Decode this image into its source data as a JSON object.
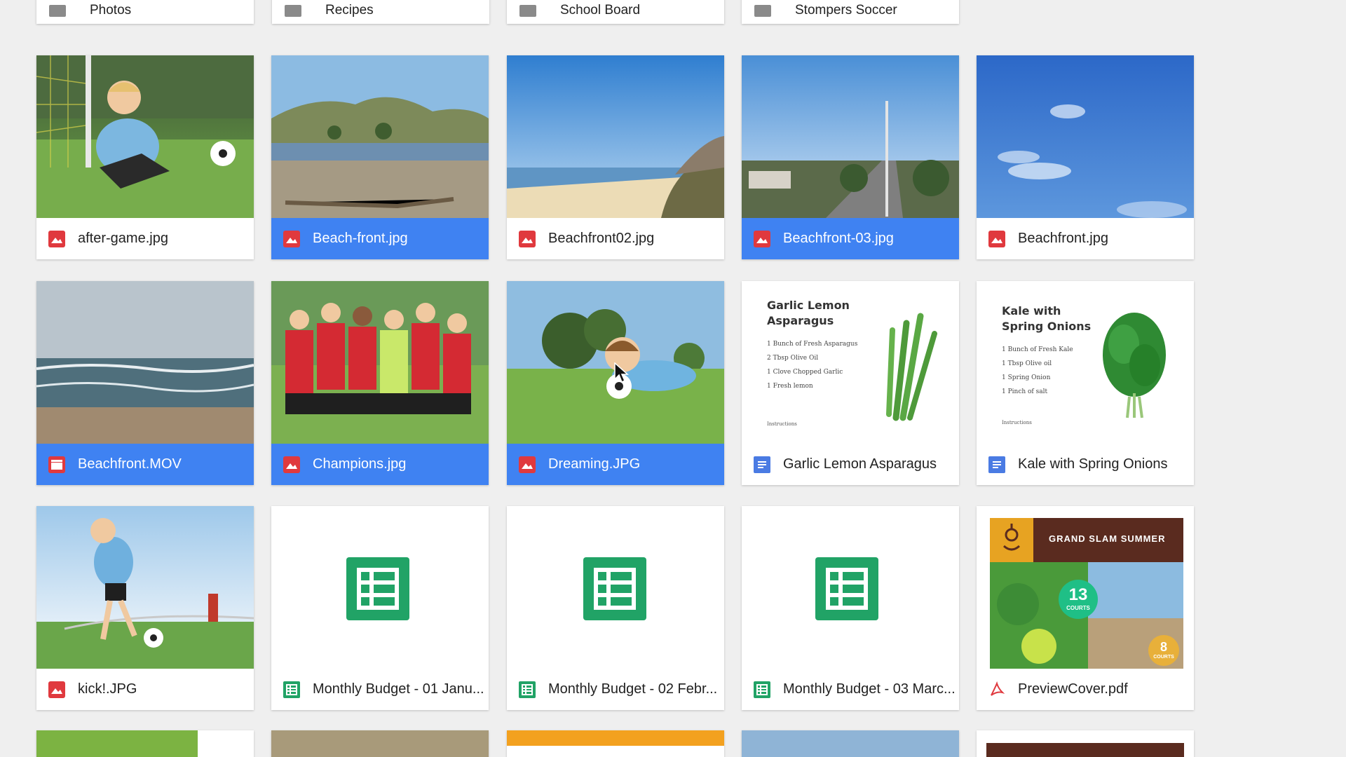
{
  "folders": [
    {
      "name": "Photos"
    },
    {
      "name": "Recipes"
    },
    {
      "name": "School Board"
    },
    {
      "name": "Stompers Soccer"
    }
  ],
  "files": [
    {
      "name": "after-game.jpg",
      "type": "image",
      "selected": false
    },
    {
      "name": "Beach-front.jpg",
      "type": "image",
      "selected": true
    },
    {
      "name": "Beachfront02.jpg",
      "type": "image",
      "selected": false
    },
    {
      "name": "Beachfront-03.jpg",
      "type": "image",
      "selected": true
    },
    {
      "name": "Beachfront.jpg",
      "type": "image",
      "selected": false
    },
    {
      "name": "Beachfront.MOV",
      "type": "video",
      "selected": true
    },
    {
      "name": "Champions.jpg",
      "type": "image",
      "selected": true
    },
    {
      "name": "Dreaming.JPG",
      "type": "image",
      "selected": true
    },
    {
      "name": "Garlic Lemon Asparagus",
      "type": "doc",
      "selected": false
    },
    {
      "name": "Kale with Spring Onions",
      "type": "doc",
      "selected": false
    },
    {
      "name": "kick!.JPG",
      "type": "image",
      "selected": false
    },
    {
      "name": "Monthly Budget - 01 Janu...",
      "type": "sheet",
      "selected": false
    },
    {
      "name": "Monthly Budget - 02 Febr...",
      "type": "sheet",
      "selected": false
    },
    {
      "name": "Monthly Budget - 03 Marc...",
      "type": "sheet",
      "selected": false
    },
    {
      "name": "PreviewCover.pdf",
      "type": "pdf",
      "selected": false
    }
  ],
  "recipes": {
    "garlic": {
      "title_line1": "Garlic Lemon",
      "title_line2": "Asparagus",
      "ingredients": [
        "1 Bunch of Fresh Asparagus",
        "2 Tbsp Olive Oil",
        "1 Clove Chopped Garlic",
        "1 Fresh lemon"
      ],
      "instructions": "Instructions"
    },
    "kale": {
      "title_line1": "Kale with",
      "title_line2": "Spring Onions",
      "ingredients": [
        "1 Bunch of Fresh Kale",
        "1 Tbsp Olive oil",
        "1 Spring Onion",
        "1 Pinch of salt"
      ],
      "instructions": "Instructions"
    }
  },
  "preview_cover": {
    "title": "GRAND SLAM SUMMER",
    "badge1_number": "13",
    "badge1_text": "COURTS",
    "badge2_number": "8",
    "badge2_text": "COURTS"
  },
  "colors": {
    "selection": "#3f82f2",
    "image_icon": "#e0393e",
    "doc_icon": "#4a7be3",
    "sheet_icon": "#21a366",
    "pdf_icon": "#e0393e"
  }
}
